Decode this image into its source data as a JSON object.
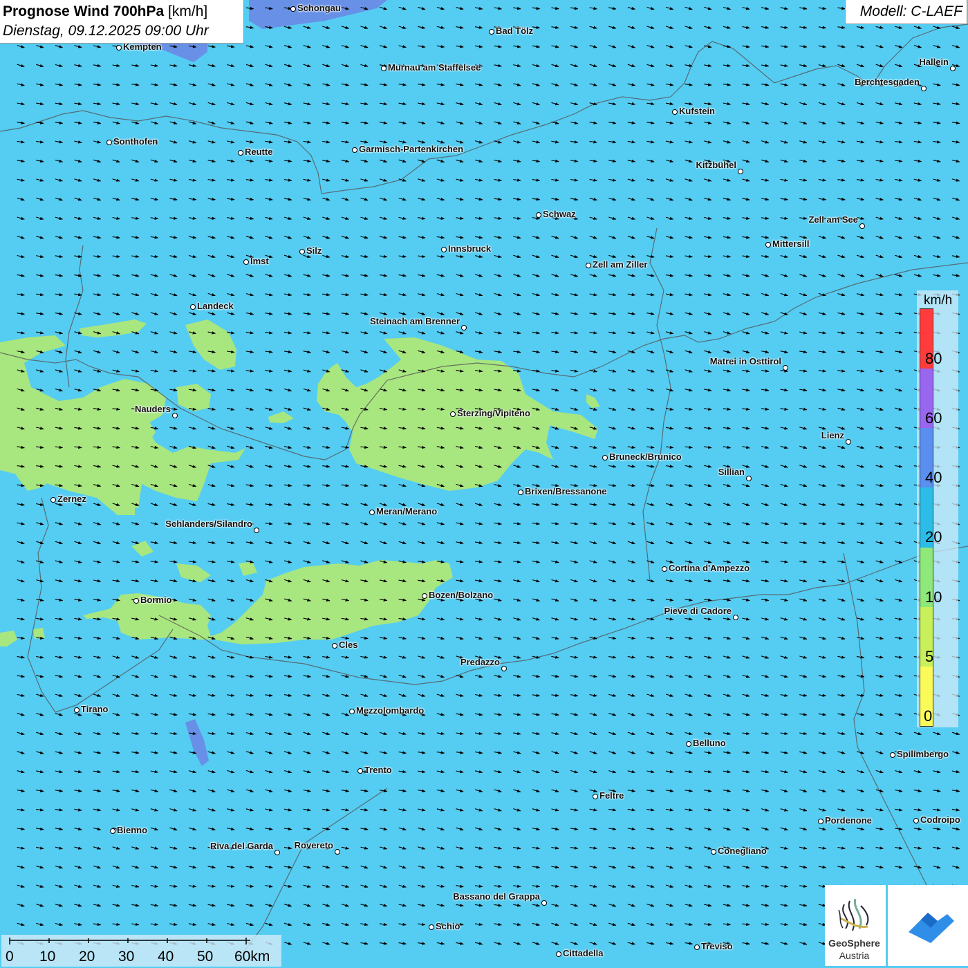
{
  "title": {
    "main": "Prognose Wind 700hPa",
    "unit": "[km/h]",
    "datetime": "Dienstag, 09.12.2025 09:00 Uhr"
  },
  "model_label": "Modell: C-LAEF",
  "colors": {
    "wind_10_20": "#55ccf2",
    "wind_5_10": "#a8e67f",
    "lake": "#6a8ae6",
    "border": "#555555",
    "arrow": "#000000"
  },
  "wind": {
    "direction": "west-southwest",
    "dominant_speed_band_kmh": "10-20",
    "weaker_patches_band_kmh": "5-10"
  },
  "legend": {
    "unit": "km/h",
    "ticks": [
      "80",
      "60",
      "40",
      "20",
      "10",
      "5",
      "0"
    ],
    "colors": [
      "#ff3b3b",
      "#9966f0",
      "#5a8ff0",
      "#2bbde8",
      "#8ee87a",
      "#c8f05a",
      "#fafa5a"
    ]
  },
  "scalebar": {
    "labels": [
      "0",
      "10",
      "20",
      "30",
      "40",
      "50",
      "60km"
    ]
  },
  "logos": {
    "geosphere_line1": "GeoSphere",
    "geosphere_line2": "Austria"
  },
  "cities": [
    {
      "name": "Schongau"
    },
    {
      "name": "Kempten"
    },
    {
      "name": "Bad Tölz"
    },
    {
      "name": "Murnau am Staffelsee"
    },
    {
      "name": "Hallein"
    },
    {
      "name": "Berchtesgaden"
    },
    {
      "name": "Kufstein"
    },
    {
      "name": "Sonthofen"
    },
    {
      "name": "Reutte"
    },
    {
      "name": "Garmisch-Partenkirchen"
    },
    {
      "name": "Kitzbühel"
    },
    {
      "name": "Schwaz"
    },
    {
      "name": "Zell am See"
    },
    {
      "name": "Mittersill"
    },
    {
      "name": "Innsbruck"
    },
    {
      "name": "Silz"
    },
    {
      "name": "Imst"
    },
    {
      "name": "Zell am Ziller"
    },
    {
      "name": "Landeck"
    },
    {
      "name": "Steinach am Brenner"
    },
    {
      "name": "Matrei in Osttirol"
    },
    {
      "name": "Nauders"
    },
    {
      "name": "Sterzing/Vipiteno"
    },
    {
      "name": "Lienz"
    },
    {
      "name": "Bruneck/Brunico"
    },
    {
      "name": "Sillian"
    },
    {
      "name": "Zernez"
    },
    {
      "name": "Brixen/Bressanone"
    },
    {
      "name": "Meran/Merano"
    },
    {
      "name": "Schlanders/Silandro"
    },
    {
      "name": "Cortina d'Ampezzo"
    },
    {
      "name": "Bozen/Bolzano"
    },
    {
      "name": "Bormio"
    },
    {
      "name": "Pieve di Cadore"
    },
    {
      "name": "Cles"
    },
    {
      "name": "Predazzo"
    },
    {
      "name": "Tirano"
    },
    {
      "name": "Mezzolombardo"
    },
    {
      "name": "Belluno"
    },
    {
      "name": "Spilimbergo"
    },
    {
      "name": "Trento"
    },
    {
      "name": "Feltre"
    },
    {
      "name": "Pordenone"
    },
    {
      "name": "Codroipo"
    },
    {
      "name": "Bienno"
    },
    {
      "name": "Riva del Garda"
    },
    {
      "name": "Rovereto"
    },
    {
      "name": "Conegliano"
    },
    {
      "name": "Bassano del Grappa"
    },
    {
      "name": "Schio"
    },
    {
      "name": "Treviso"
    },
    {
      "name": "Cittadella"
    }
  ]
}
